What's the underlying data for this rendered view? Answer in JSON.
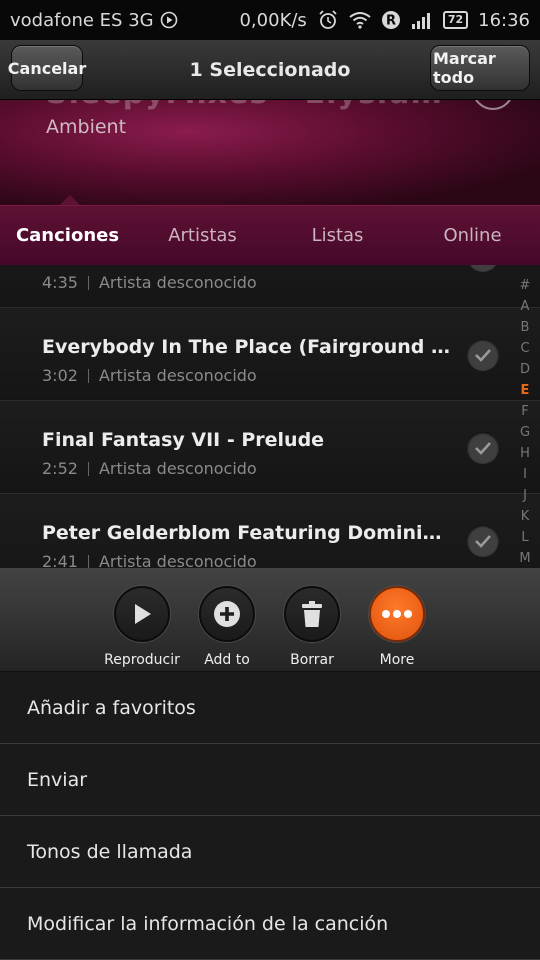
{
  "status_bar": {
    "carrier": "vodafone ES 3G",
    "speed": "0,00K/s",
    "battery": "72",
    "time": "16:36"
  },
  "top_bar": {
    "cancel_label": "Cancelar",
    "title": "1 Seleccionado",
    "select_all_label": "Marcar todo"
  },
  "header": {
    "album_title": "SleepyMixes - Elysium",
    "genre": "Ambient"
  },
  "tabs": [
    {
      "label": "Canciones",
      "active": true
    },
    {
      "label": "Artistas",
      "active": false
    },
    {
      "label": "Listas",
      "active": false
    },
    {
      "label": "Online",
      "active": false
    }
  ],
  "songs": [
    {
      "title": "",
      "duration": "4:35",
      "artist": "Artista desconocido"
    },
    {
      "title": "Everybody In The Place (Fairground Remix)",
      "duration": "3:02",
      "artist": "Artista desconocido"
    },
    {
      "title": "Final Fantasy VII - Prelude",
      "duration": "2:52",
      "artist": "Artista desconocido"
    },
    {
      "title": "Peter Gelderblom Featuring Dominica - I…",
      "duration": "2:41",
      "artist": "Artista desconocido"
    }
  ],
  "alphabet_index": {
    "letters": [
      "#",
      "A",
      "B",
      "C",
      "D",
      "E",
      "F",
      "G",
      "H",
      "I",
      "J",
      "K",
      "L",
      "M"
    ],
    "active": "E"
  },
  "actions": [
    {
      "label": "Reproducir",
      "icon": "play-icon"
    },
    {
      "label": "Add to",
      "icon": "plus-icon"
    },
    {
      "label": "Borrar",
      "icon": "trash-icon"
    },
    {
      "label": "More",
      "icon": "more-dots-icon"
    }
  ],
  "menu": [
    {
      "label": "Añadir a favoritos"
    },
    {
      "label": "Enviar"
    },
    {
      "label": "Tonos de llamada"
    },
    {
      "label": "Modificar la información de la canción"
    }
  ],
  "colors": {
    "accent": "#e86a1a",
    "header_magenta": "#5c1333"
  }
}
